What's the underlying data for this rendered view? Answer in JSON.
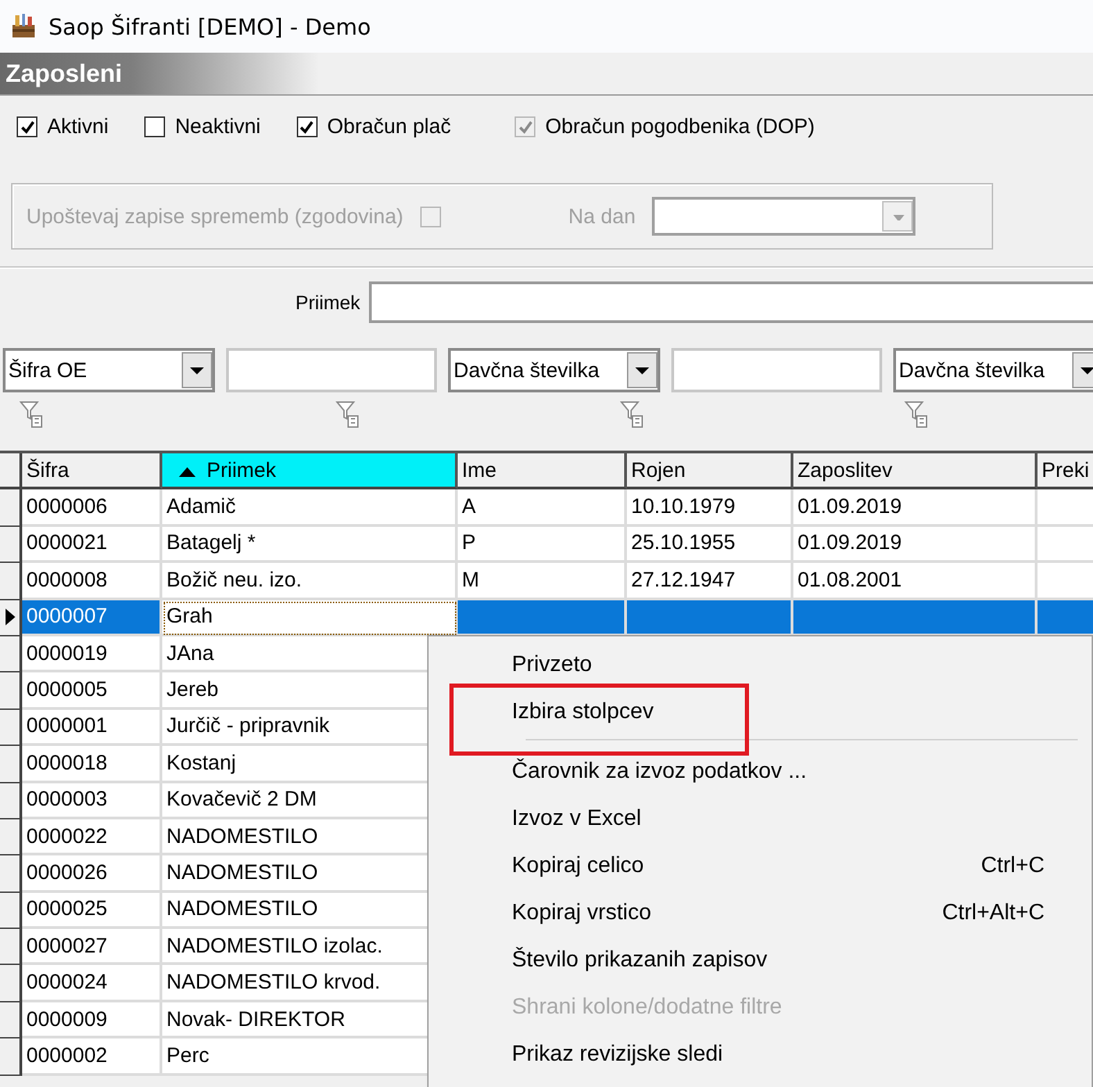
{
  "window": {
    "title": "Saop Šifranti [DEMO] - Demo"
  },
  "section": {
    "title": "Zaposleni"
  },
  "filters": [
    {
      "label": "Aktivni",
      "checked": true,
      "disabled": false
    },
    {
      "label": "Neaktivni",
      "checked": false,
      "disabled": false
    },
    {
      "label": "Obračun plač",
      "checked": true,
      "disabled": false
    },
    {
      "label": "Obračun pogodbenika (DOP)",
      "checked": true,
      "disabled": true
    }
  ],
  "history": {
    "label": "Upoštevaj zapise sprememb (zgodovina)",
    "checked": false,
    "disabled": true,
    "date_label": "Na dan"
  },
  "surname_search": {
    "label": "Priimek"
  },
  "filter_row": [
    {
      "kind": "combo",
      "value": "Šifra OE"
    },
    {
      "kind": "input"
    },
    {
      "kind": "combo",
      "value": "Davčna številka"
    },
    {
      "kind": "input"
    },
    {
      "kind": "combo",
      "value": "Davčna številka"
    }
  ],
  "table": {
    "columns": [
      {
        "label": "Šifra",
        "sorted": false
      },
      {
        "label": "Priimek",
        "sorted": true
      },
      {
        "label": "Ime",
        "sorted": false
      },
      {
        "label": "Rojen",
        "sorted": false
      },
      {
        "label": "Zaposlitev",
        "sorted": false
      },
      {
        "label": "Preki",
        "sorted": false
      }
    ],
    "rows": [
      {
        "selected": false,
        "cells": [
          "0000006",
          "Adamič",
          "A",
          "10.10.1979",
          "01.09.2019"
        ]
      },
      {
        "selected": false,
        "cells": [
          "0000021",
          "Batagelj *",
          "P",
          "25.10.1955",
          "01.09.2019"
        ]
      },
      {
        "selected": false,
        "cells": [
          "0000008",
          "Božič neu. izo.",
          "M",
          "27.12.1947",
          "01.08.2001"
        ]
      },
      {
        "selected": true,
        "cells": [
          "0000007",
          "Grah"
        ]
      },
      {
        "selected": false,
        "cells": [
          "0000019",
          "JAna"
        ]
      },
      {
        "selected": false,
        "cells": [
          "0000005",
          "Jereb"
        ]
      },
      {
        "selected": false,
        "cells": [
          "0000001",
          "Jurčič - pripravnik"
        ]
      },
      {
        "selected": false,
        "cells": [
          "0000018",
          "Kostanj"
        ]
      },
      {
        "selected": false,
        "cells": [
          "0000003",
          "Kovačevič 2 DM"
        ]
      },
      {
        "selected": false,
        "cells": [
          "0000022",
          "NADOMESTILO"
        ]
      },
      {
        "selected": false,
        "cells": [
          "0000026",
          "NADOMESTILO"
        ]
      },
      {
        "selected": false,
        "cells": [
          "0000025",
          "NADOMESTILO"
        ]
      },
      {
        "selected": false,
        "cells": [
          "0000027",
          "NADOMESTILO izolac."
        ]
      },
      {
        "selected": false,
        "cells": [
          "0000024",
          "NADOMESTILO krvod."
        ]
      },
      {
        "selected": false,
        "cells": [
          "0000009",
          "Novak- DIREKTOR"
        ]
      },
      {
        "selected": false,
        "cells": [
          "0000002",
          "Perc"
        ]
      }
    ]
  },
  "context_menu": {
    "items": [
      {
        "kind": "item",
        "label": "Privzeto",
        "disabled": false,
        "annotated": false
      },
      {
        "kind": "item",
        "label": "Izbira stolpcev",
        "disabled": false,
        "annotated": true
      },
      {
        "kind": "separator"
      },
      {
        "kind": "item",
        "label": "Čarovnik za izvoz podatkov ...",
        "disabled": false,
        "annotated": false
      },
      {
        "kind": "item",
        "label": "Izvoz v Excel",
        "disabled": false,
        "annotated": false
      },
      {
        "kind": "item",
        "label": "Kopiraj celico",
        "shortcut": "Ctrl+C",
        "disabled": false,
        "annotated": false
      },
      {
        "kind": "item",
        "label": "Kopiraj vrstico",
        "shortcut": "Ctrl+Alt+C",
        "disabled": false,
        "annotated": false
      },
      {
        "kind": "item",
        "label": "Število prikazanih zapisov",
        "disabled": false,
        "annotated": false
      },
      {
        "kind": "item",
        "label": "Shrani kolone/dodatne filtre",
        "disabled": true,
        "annotated": false
      },
      {
        "kind": "item",
        "label": "Prikaz revizijske sledi",
        "disabled": false,
        "annotated": false
      }
    ]
  }
}
